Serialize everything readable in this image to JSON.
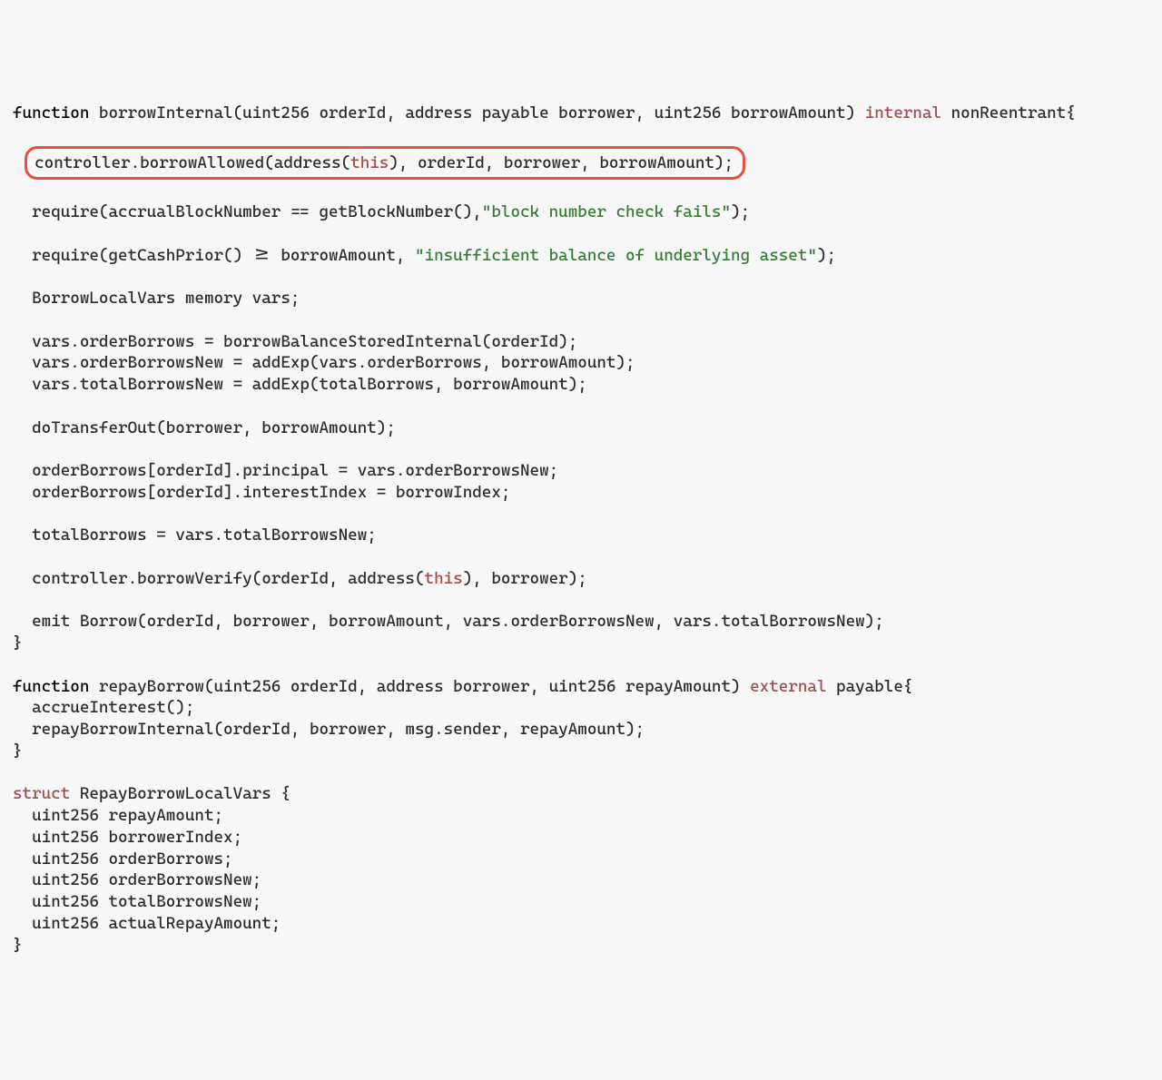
{
  "code": {
    "fn_kw": "function",
    "sig1_a": " borrowInternal(uint256 orderId, address payable borrower, uint256 borrowAmount) ",
    "sig1_mod": "internal",
    "sig1_b": " nonReentrant{",
    "boxed_a": "controller.borrowAllowed(address(",
    "boxed_this": "this",
    "boxed_b": "), orderId, borrower, borrowAmount);",
    "req1_a": "require(accrualBlockNumber == getBlockNumber(),",
    "req1_str": "\"block number check fails\"",
    "req1_b": ");",
    "req2_a": "require(getCashPrior() >= borrowAmount, ",
    "req2_str": "\"insufficient balance of underlying asset\"",
    "req2_b": ");",
    "vars_decl": "BorrowLocalVars memory vars;",
    "a1": "vars.orderBorrows = borrowBalanceStoredInternal(orderId);",
    "a2": "vars.orderBorrowsNew = addExp(vars.orderBorrows, borrowAmount);",
    "a3": "vars.totalBorrowsNew = addExp(totalBorrows, borrowAmount);",
    "t1": "doTransferOut(borrower, borrowAmount);",
    "o1": "orderBorrows[orderId].principal = vars.orderBorrowsNew;",
    "o2": "orderBorrows[orderId].interestIndex = borrowIndex;",
    "tb": "totalBorrows = vars.totalBorrowsNew;",
    "verify_a": "controller.borrowVerify(orderId, address(",
    "verify_this": "this",
    "verify_b": "), borrower);",
    "emit": "emit Borrow(orderId, borrower, borrowAmount, vars.orderBorrowsNew, vars.totalBorrowsNew);",
    "close1": "}",
    "sig2_a": " repayBorrow(uint256 orderId, address borrower, uint256 repayAmount) ",
    "sig2_mod": "external",
    "sig2_b": " payable{",
    "r1": "accrueInterest();",
    "r2": "repayBorrowInternal(orderId, borrower, msg.sender, repayAmount);",
    "close2": "}",
    "struct_kw": "struct",
    "struct_name": " RepayBorrowLocalVars {",
    "s1": "uint256 repayAmount;",
    "s2": "uint256 borrowerIndex;",
    "s3": "uint256 orderBorrows;",
    "s4": "uint256 orderBorrowsNew;",
    "s5": "uint256 totalBorrowsNew;",
    "s6": "uint256 actualRepayAmount;",
    "close3": "}"
  }
}
